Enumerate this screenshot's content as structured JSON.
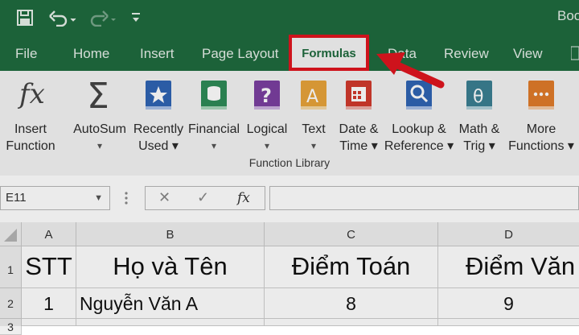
{
  "titlebar": {
    "title_partial": "Boo",
    "save_icon": "save-icon",
    "undo_icon": "undo-icon",
    "redo_icon": "redo-icon",
    "customize_icon": "customize-icon"
  },
  "tabs": [
    {
      "label": "File"
    },
    {
      "label": "Home"
    },
    {
      "label": "Insert"
    },
    {
      "label": "Page Layout"
    },
    {
      "label": "Formulas"
    },
    {
      "label": "Data"
    },
    {
      "label": "Review"
    },
    {
      "label": "View"
    }
  ],
  "ribbon": {
    "buttons": [
      {
        "line1": "Insert",
        "line2": "Function",
        "icon": "fx-icon"
      },
      {
        "line1": "AutoSum",
        "line2": "▾",
        "icon": "sigma-icon"
      },
      {
        "line1": "Recently",
        "line2": "Used ▾",
        "icon": "star-book-icon"
      },
      {
        "line1": "Financial",
        "line2": "▾",
        "icon": "coins-book-icon"
      },
      {
        "line1": "Logical",
        "line2": "▾",
        "icon": "question-book-icon"
      },
      {
        "line1": "Text",
        "line2": "▾",
        "icon": "text-book-icon"
      },
      {
        "line1": "Date &",
        "line2": "Time ▾",
        "icon": "calendar-book-icon"
      },
      {
        "line1": "Lookup &",
        "line2": "Reference ▾",
        "icon": "magnifier-book-icon"
      },
      {
        "line1": "Math &",
        "line2": "Trig ▾",
        "icon": "theta-book-icon"
      },
      {
        "line1": "More",
        "line2": "Functions ▾",
        "icon": "more-book-icon"
      }
    ],
    "group_label": "Function Library"
  },
  "formula_bar": {
    "name_box": "E11",
    "cancel": "✕",
    "enter": "✓",
    "fx": "fx",
    "value": ""
  },
  "columns": [
    "A",
    "B",
    "C",
    "D"
  ],
  "rows": [
    "1",
    "2",
    "3"
  ],
  "table": {
    "header": [
      "STT",
      "Họ và Tên",
      "Điểm Toán",
      "Điểm Văn"
    ],
    "row1": [
      "1",
      "Nguyễn Văn A",
      "8",
      "9"
    ]
  },
  "colors": {
    "excel_green": "#1f6b3e",
    "highlight_red": "#e0151f",
    "ribbon_bg": "#f3f3f3"
  }
}
